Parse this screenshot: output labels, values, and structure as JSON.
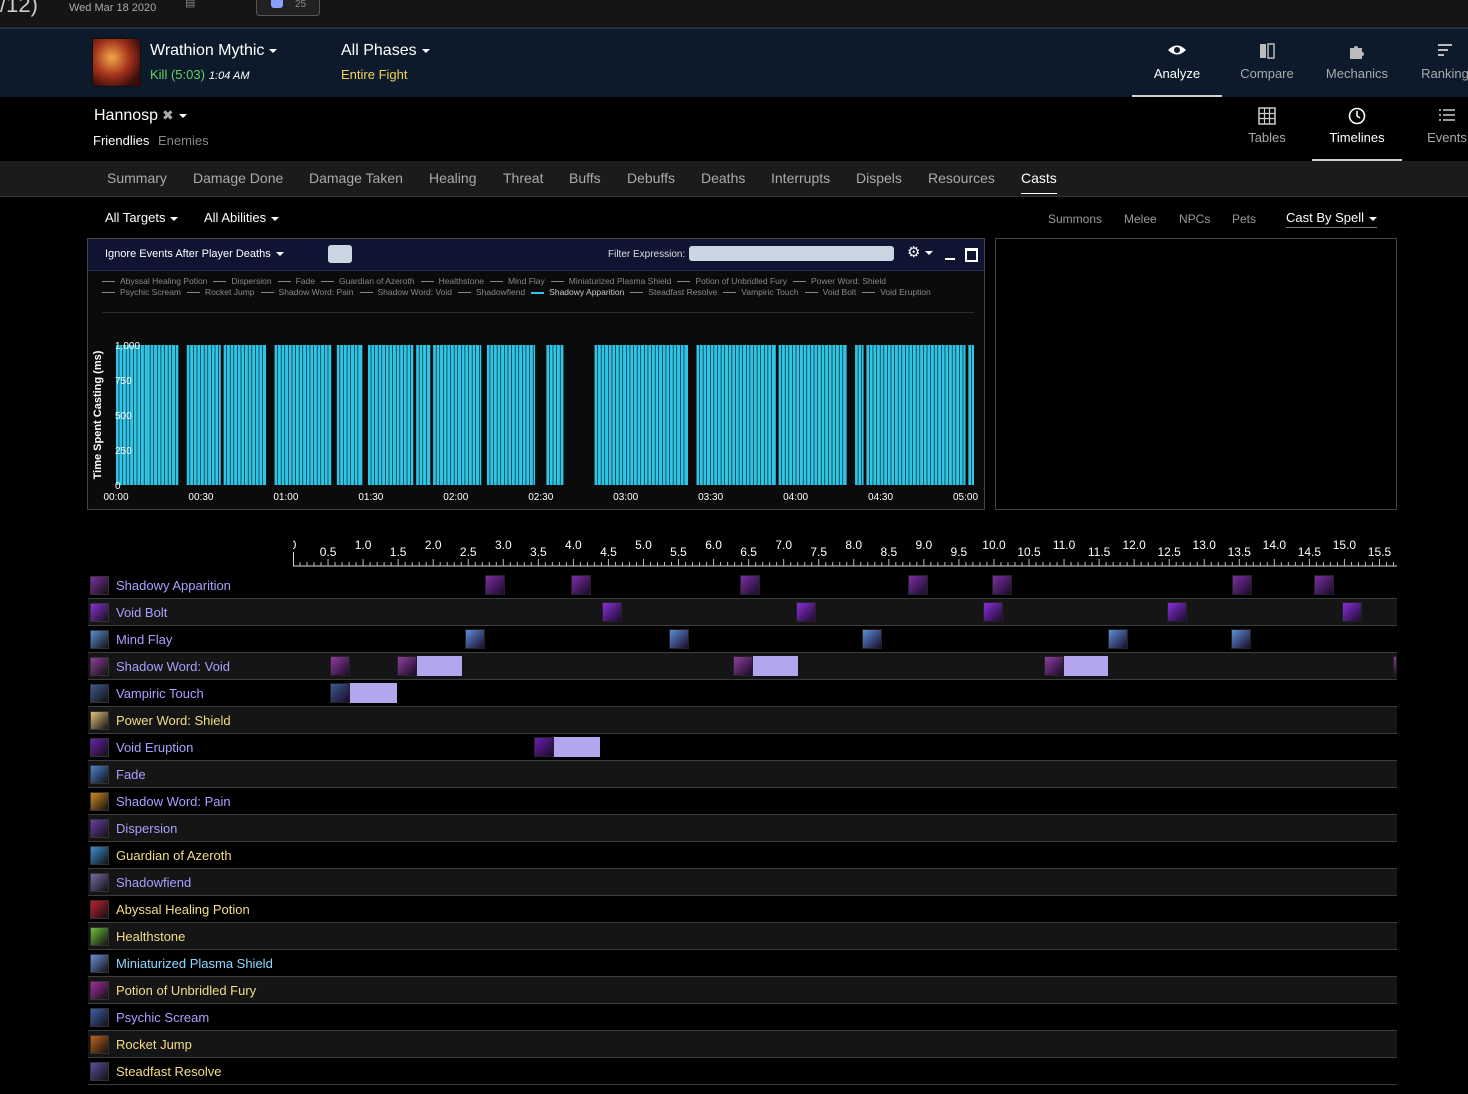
{
  "topstrip": {
    "fragment": "/12)",
    "date": "Wed Mar 18 2020",
    "chat_count": "25"
  },
  "header": {
    "encounter": "Wrathion Mythic",
    "result": "Kill (5:03)",
    "time": "1:04 AM",
    "phase": "All Phases",
    "phase_sub": "Entire Fight",
    "nav": [
      {
        "label": "Analyze",
        "icon": "eye-icon",
        "active": true
      },
      {
        "label": "Compare",
        "icon": "compare-icon",
        "active": false
      },
      {
        "label": "Mechanics",
        "icon": "puzzle-icon",
        "active": false
      },
      {
        "label": "Ranking",
        "icon": "ranking-icon",
        "active": false
      }
    ]
  },
  "player": {
    "name": "Hannosp",
    "friendlies": "Friendlies",
    "enemies": "Enemies",
    "views": [
      {
        "label": "Tables",
        "icon": "grid-icon",
        "active": false
      },
      {
        "label": "Timelines",
        "icon": "clock-icon",
        "active": true
      },
      {
        "label": "Events",
        "icon": "list-icon",
        "active": false
      }
    ]
  },
  "tabs": [
    "Summary",
    "Damage Done",
    "Damage Taken",
    "Healing",
    "Threat",
    "Buffs",
    "Debuffs",
    "Deaths",
    "Interrupts",
    "Dispels",
    "Resources",
    "Casts"
  ],
  "active_tab": "Casts",
  "filters": {
    "targets": "All Targets",
    "abilities": "All Abilities",
    "right": [
      "Summons",
      "Melee",
      "NPCs",
      "Pets"
    ],
    "cast_by": "Cast By Spell"
  },
  "chart_panel": {
    "ignore_label": "Ignore Events After Player Deaths",
    "filter_label": "Filter Expression:",
    "filter_value": ""
  },
  "chart_data": {
    "type": "bar",
    "ylabel": "Time Spent Casting (ms)",
    "ylim": [
      0,
      1000
    ],
    "y_ticks": [
      "0",
      "250",
      "500",
      "750",
      "1,000"
    ],
    "x_ticks": [
      "00:00",
      "00:30",
      "01:00",
      "01:30",
      "02:00",
      "02:30",
      "03:00",
      "03:30",
      "04:00",
      "04:30",
      "05:00"
    ],
    "xlim_seconds": [
      0,
      303
    ],
    "legend": [
      "Abyssal Healing Potion",
      "Dispersion",
      "Fade",
      "Guardian of Azeroth",
      "Healthstone",
      "Mind Flay",
      "Miniaturized Plasma Shield",
      "Potion of Unbridled Fury",
      "Power Word: Shield",
      "Psychic Scream",
      "Rocket Jump",
      "Shadow Word: Pain",
      "Shadow Word: Void",
      "Shadowfiend",
      "Shadowy Apparition",
      "Steadfast Resolve",
      "Vampiric Touch",
      "Void Bolt",
      "Void Eruption"
    ],
    "selected_series": "Shadowy Apparition",
    "series_color": "#2ec5e6",
    "series": [
      {
        "name": "Shadowy Apparition",
        "value": 1000,
        "active_ranges_seconds": [
          [
            0,
            11
          ],
          [
            11,
            22
          ],
          [
            25,
            37
          ],
          [
            38,
            53
          ],
          [
            56,
            76
          ],
          [
            78,
            87
          ],
          [
            89,
            105
          ],
          [
            106,
            111
          ],
          [
            112,
            129
          ],
          [
            131,
            148
          ],
          [
            152,
            158
          ],
          [
            169,
            202
          ],
          [
            205,
            233
          ],
          [
            234,
            258
          ],
          [
            261,
            264
          ],
          [
            265,
            300
          ],
          [
            301,
            303
          ]
        ]
      }
    ]
  },
  "timeline": {
    "scale_labels": [
      "0",
      "0.5",
      "1.0",
      "1.5",
      "2.0",
      "2.5",
      "3.0",
      "3.5",
      "4.0",
      "4.5",
      "5.0",
      "5.5",
      "6.0",
      "6.5",
      "7.0",
      "7.5",
      "8.0",
      "8.5",
      "9.0",
      "9.5",
      "10.0",
      "10.5",
      "11.0",
      "11.5",
      "12.0",
      "12.5",
      "13.0",
      "13.5",
      "14.0",
      "14.5",
      "15.0",
      "15.5"
    ],
    "scale_max": 15.75,
    "rows": [
      {
        "name": "Shadowy Apparition",
        "color": "#a8a0ff",
        "icon": "shadowy-apparition-icon",
        "icon_color": "#7a2fa0",
        "events": [
          [
            2.74,
            0
          ],
          [
            3.97,
            0
          ],
          [
            6.37,
            0
          ],
          [
            8.78,
            0
          ],
          [
            9.97,
            0
          ],
          [
            13.4,
            0
          ],
          [
            14.56,
            0
          ]
        ]
      },
      {
        "name": "Void Bolt",
        "color": "#a8a0ff",
        "icon": "void-bolt-icon",
        "icon_color": "#8a2fd9",
        "events": [
          [
            4.41,
            0
          ],
          [
            7.18,
            0
          ],
          [
            9.84,
            0
          ],
          [
            12.47,
            0
          ],
          [
            14.96,
            0
          ]
        ]
      },
      {
        "name": "Mind Flay",
        "color": "#a8a0ff",
        "icon": "mind-flay-icon",
        "icon_color": "#5c8fd6",
        "events": [
          [
            2.45,
            0
          ],
          [
            5.36,
            0
          ],
          [
            8.12,
            0
          ],
          [
            11.63,
            0
          ],
          [
            13.38,
            0
          ]
        ]
      },
      {
        "name": "Shadow Word: Void",
        "color": "#a8a0ff",
        "icon": "shadow-word-void-icon",
        "icon_color": "#8e3f9a",
        "events": [
          [
            0.53,
            0
          ],
          [
            1.48,
            0.93
          ],
          [
            6.28,
            0.93
          ],
          [
            10.72,
            0.91
          ],
          [
            15.7,
            0
          ]
        ]
      },
      {
        "name": "Vampiric Touch",
        "color": "#a8a0ff",
        "icon": "vampiric-touch-icon",
        "icon_color": "#3a5c8e",
        "events": [
          [
            0.53,
            0.96
          ]
        ]
      },
      {
        "name": "Power Word: Shield",
        "color": "#f5dd86",
        "icon": "power-word-shield-icon",
        "icon_color": "#e3c27a",
        "events": []
      },
      {
        "name": "Void Eruption",
        "color": "#a8a0ff",
        "icon": "void-eruption-icon",
        "icon_color": "#6a1fb0",
        "events": [
          [
            3.44,
            0.94
          ]
        ]
      },
      {
        "name": "Fade",
        "color": "#a8a0ff",
        "icon": "fade-icon",
        "icon_color": "#4d7fd0",
        "events": []
      },
      {
        "name": "Shadow Word: Pain",
        "color": "#a8a0ff",
        "icon": "shadow-word-pain-icon",
        "icon_color": "#d08a1e",
        "events": []
      },
      {
        "name": "Dispersion",
        "color": "#a8a0ff",
        "icon": "dispersion-icon",
        "icon_color": "#6b3fa8",
        "events": []
      },
      {
        "name": "Guardian of Azeroth",
        "color": "#f5dd86",
        "icon": "guardian-of-azeroth-icon",
        "icon_color": "#3d8fd6",
        "events": []
      },
      {
        "name": "Shadowfiend",
        "color": "#a8a0ff",
        "icon": "shadowfiend-icon",
        "icon_color": "#7a6aa8",
        "events": []
      },
      {
        "name": "Abyssal Healing Potion",
        "color": "#f5dd86",
        "icon": "abyssal-healing-potion-icon",
        "icon_color": "#c21f2f",
        "events": []
      },
      {
        "name": "Healthstone",
        "color": "#f5dd86",
        "icon": "healthstone-icon",
        "icon_color": "#6fbf3a",
        "events": []
      },
      {
        "name": "Miniaturized Plasma Shield",
        "color": "#8fd8ff",
        "icon": "miniaturized-plasma-shield-icon",
        "icon_color": "#6b8fd6",
        "events": []
      },
      {
        "name": "Potion of Unbridled Fury",
        "color": "#f5dd86",
        "icon": "potion-of-unbridled-fury-icon",
        "icon_color": "#a22fa0",
        "events": []
      },
      {
        "name": "Psychic Scream",
        "color": "#a8a0ff",
        "icon": "psychic-scream-icon",
        "icon_color": "#3f5fae",
        "events": []
      },
      {
        "name": "Rocket Jump",
        "color": "#f5dd86",
        "icon": "rocket-jump-icon",
        "icon_color": "#c2621f",
        "events": []
      },
      {
        "name": "Steadfast Resolve",
        "color": "#f5dd86",
        "icon": "steadfast-resolve-icon",
        "icon_color": "#5b4fa0",
        "events": []
      }
    ]
  }
}
